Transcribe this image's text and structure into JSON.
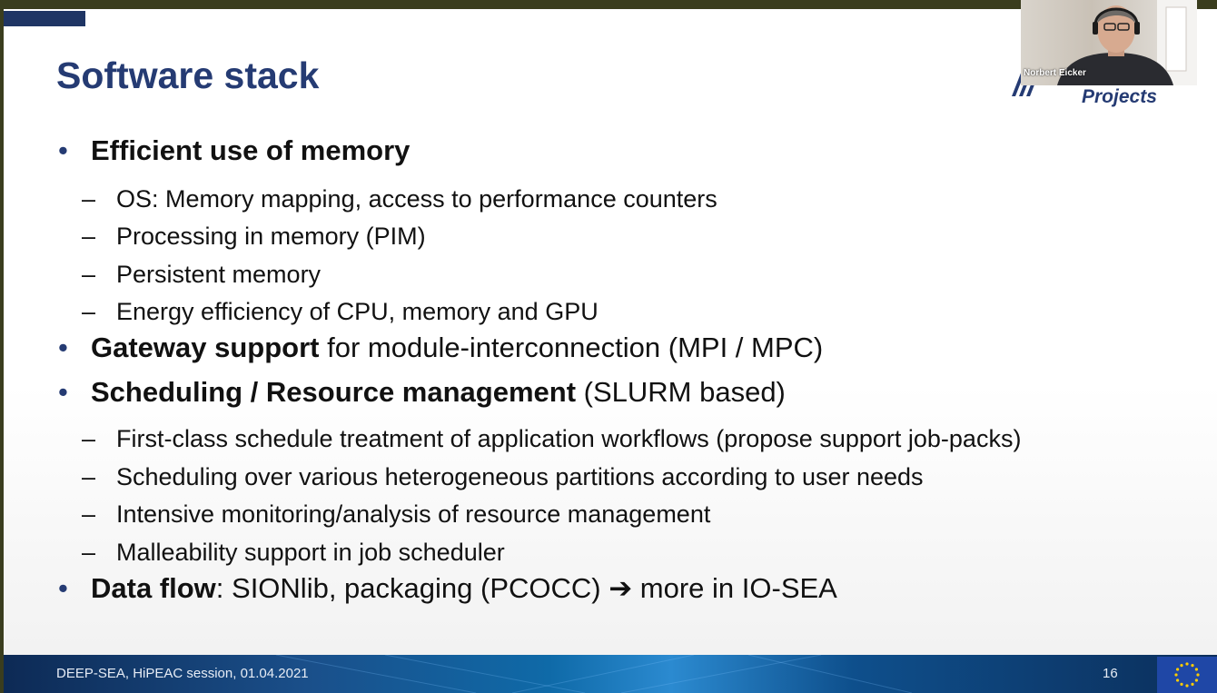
{
  "slide": {
    "title": "Software stack",
    "logo_label": "Projects",
    "bullets": [
      {
        "bold": "Efficient use of memory",
        "text": ""
      },
      {
        "sub": "OS: Memory mapping, access to performance counters"
      },
      {
        "sub": "Processing in memory (PIM)"
      },
      {
        "sub": "Persistent memory"
      },
      {
        "sub": "Energy efficiency of CPU, memory and GPU"
      },
      {
        "bold": "Gateway support",
        "text": " for module-interconnection (MPI / MPC)"
      },
      {
        "bold": "Scheduling / Resource management",
        "text": " (SLURM based)"
      },
      {
        "sub": "First-class schedule treatment of application workflows (propose support job-packs)"
      },
      {
        "sub": "Scheduling over various heterogeneous partitions according to user needs"
      },
      {
        "sub": "Intensive monitoring/analysis of resource management"
      },
      {
        "sub": "Malleability support in job scheduler"
      },
      {
        "bold": "Data flow",
        "text": ": SIONlib, packaging (PCOCC) ➔ more in IO-SEA"
      }
    ],
    "markers": {
      "bullet": "•",
      "dash": "–"
    },
    "footer": "DEEP-SEA, HiPEAC session, 01.04.2021",
    "page_number": "16"
  },
  "webcam": {
    "name": "Norbert Eicker"
  },
  "colors": {
    "title": "#253b73",
    "footer": "#0d2a55",
    "eu_flag": "#1f47a6",
    "eu_stars": "#ffcc00"
  }
}
